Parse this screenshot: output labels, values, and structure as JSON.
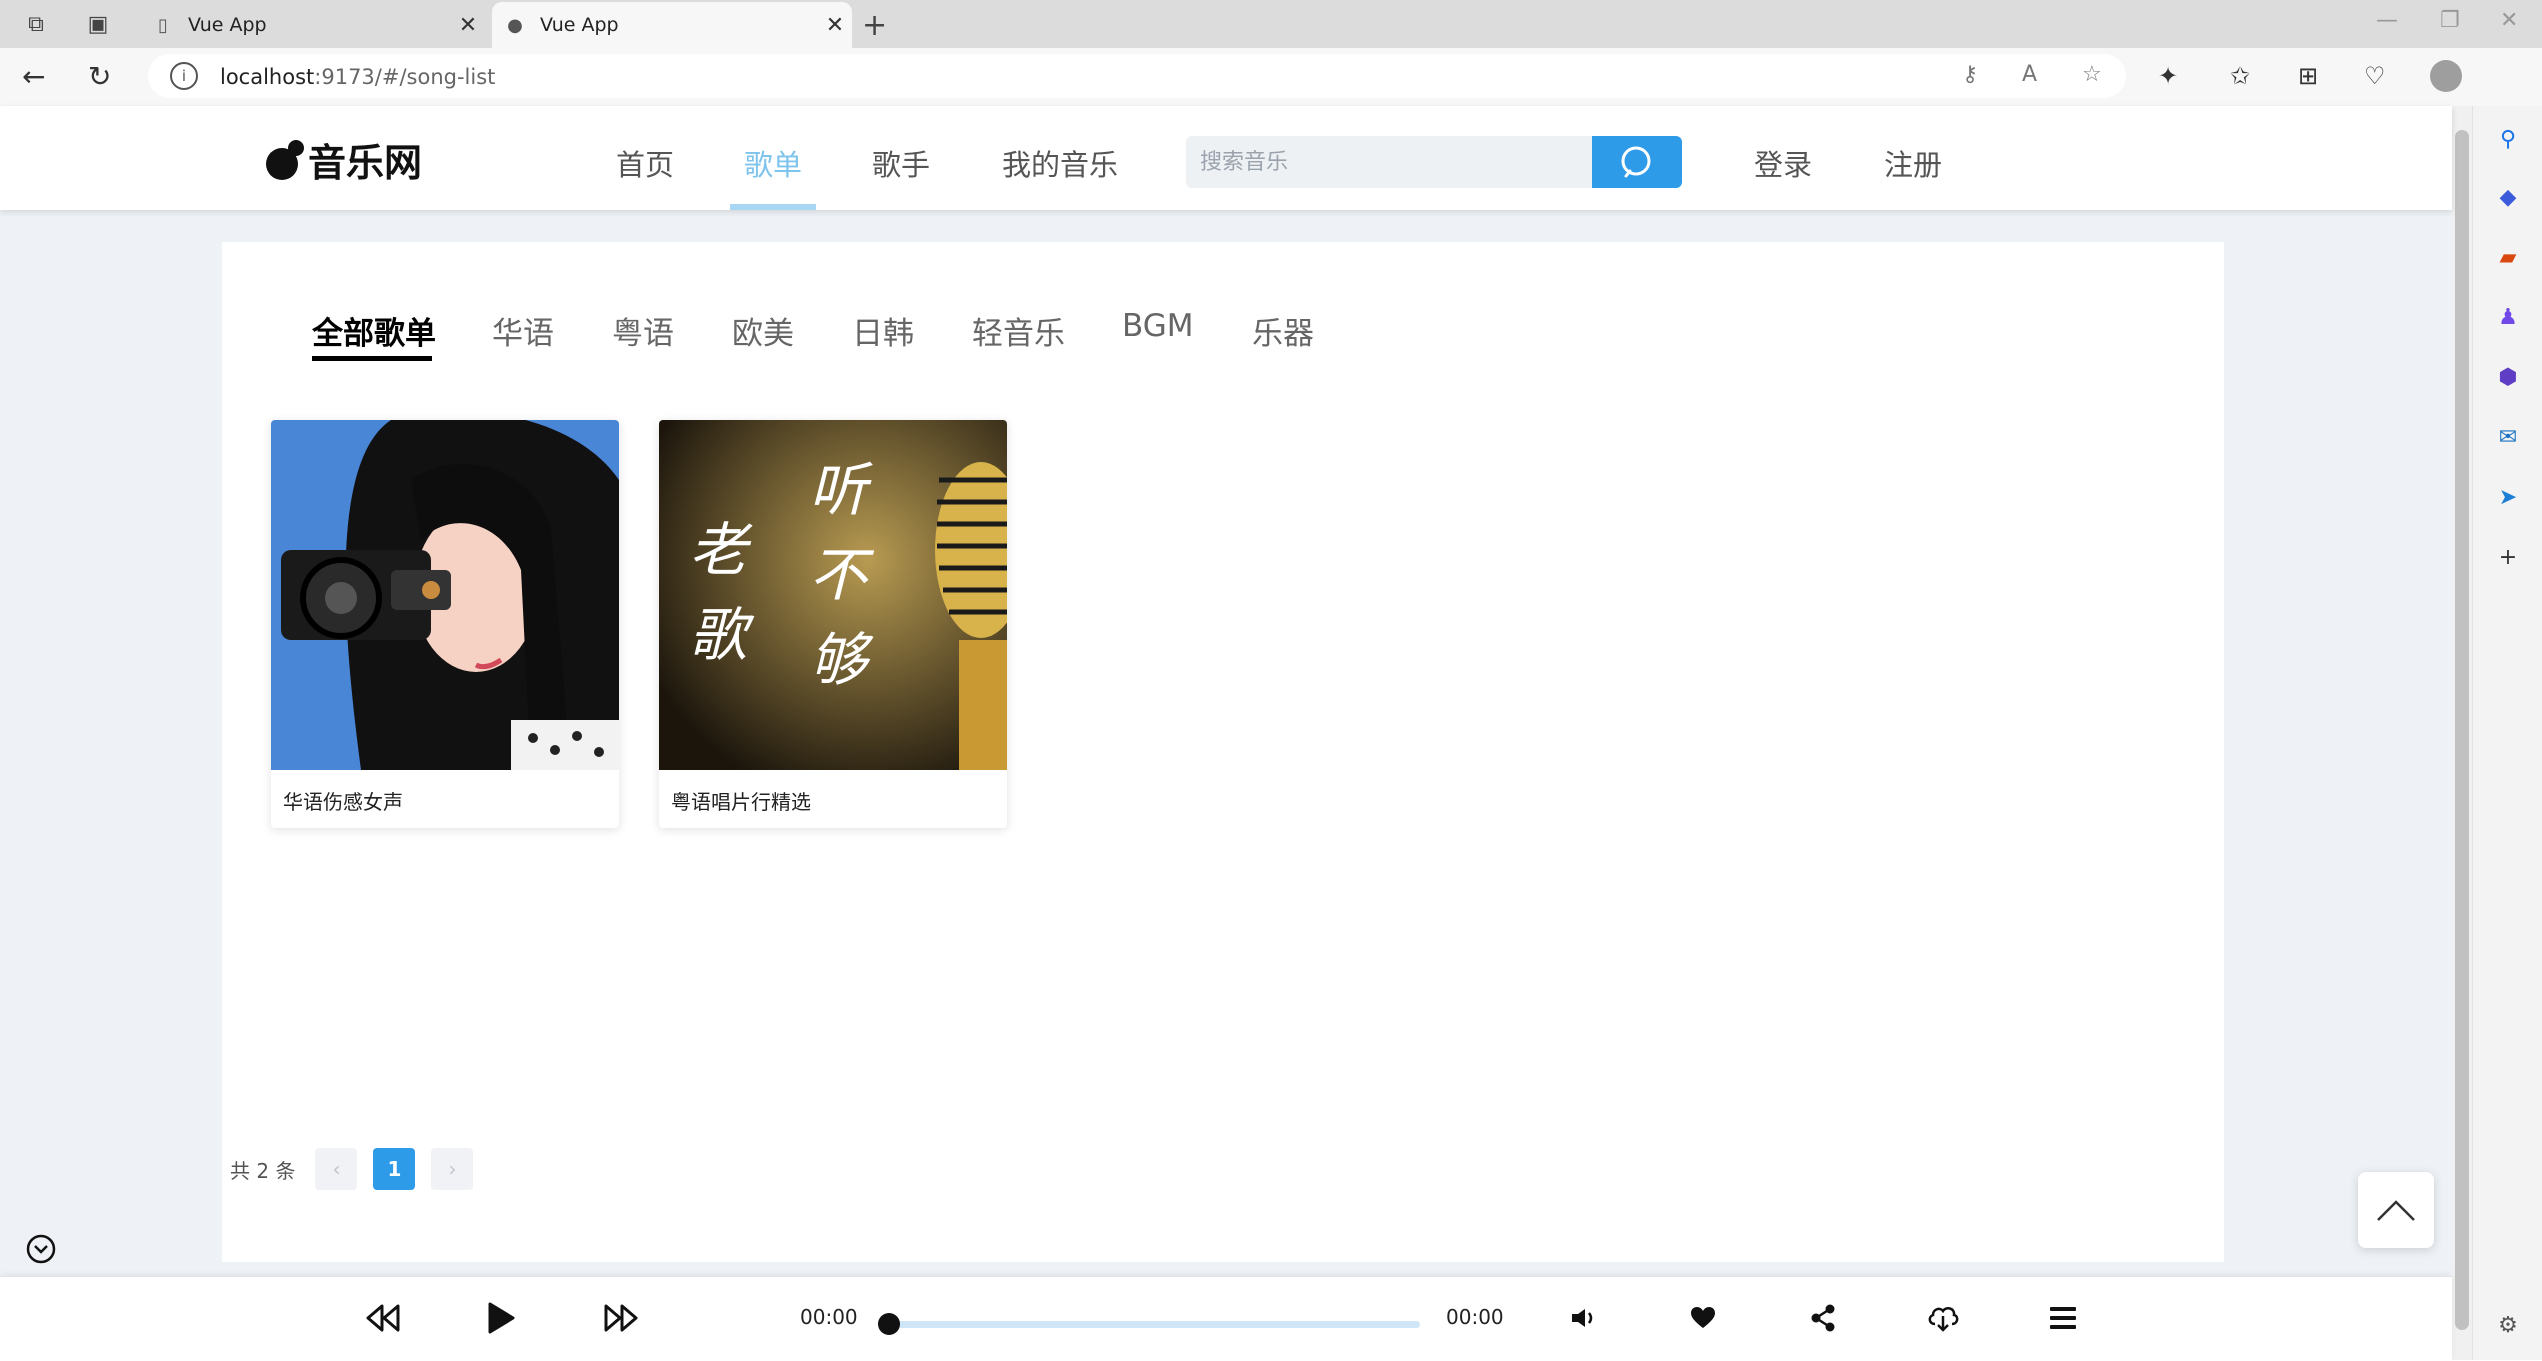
{
  "browser": {
    "tabs": [
      {
        "title": "Vue App",
        "active": false
      },
      {
        "title": "Vue App",
        "active": true
      }
    ],
    "url_host": "localhost",
    "url_rest": ":9173/#/song-list"
  },
  "header": {
    "logo_text": "音乐网",
    "nav": [
      {
        "label": "首页",
        "active": false
      },
      {
        "label": "歌单",
        "active": true
      },
      {
        "label": "歌手",
        "active": false
      },
      {
        "label": "我的音乐",
        "active": false
      }
    ],
    "search_placeholder": "搜索音乐",
    "login": "登录",
    "register": "注册"
  },
  "categories": [
    "全部歌单",
    "华语",
    "粤语",
    "欧美",
    "日韩",
    "轻音乐",
    "BGM",
    "乐器"
  ],
  "active_category": "全部歌单",
  "playlists": [
    {
      "name": "华语伤感女声"
    },
    {
      "name": "粤语唱片行精选",
      "cover_text": [
        "听",
        "不",
        "够",
        "老",
        "歌"
      ]
    }
  ],
  "pagination": {
    "total_text": "共 2 条",
    "prev": "‹",
    "current": "1",
    "next": "›"
  },
  "player": {
    "current_time": "00:00",
    "duration": "00:00",
    "progress": 0
  },
  "colors": {
    "accent": "#2e9be8",
    "nav_active": "#7ec4ec",
    "page_bg": "#eef2f6"
  }
}
